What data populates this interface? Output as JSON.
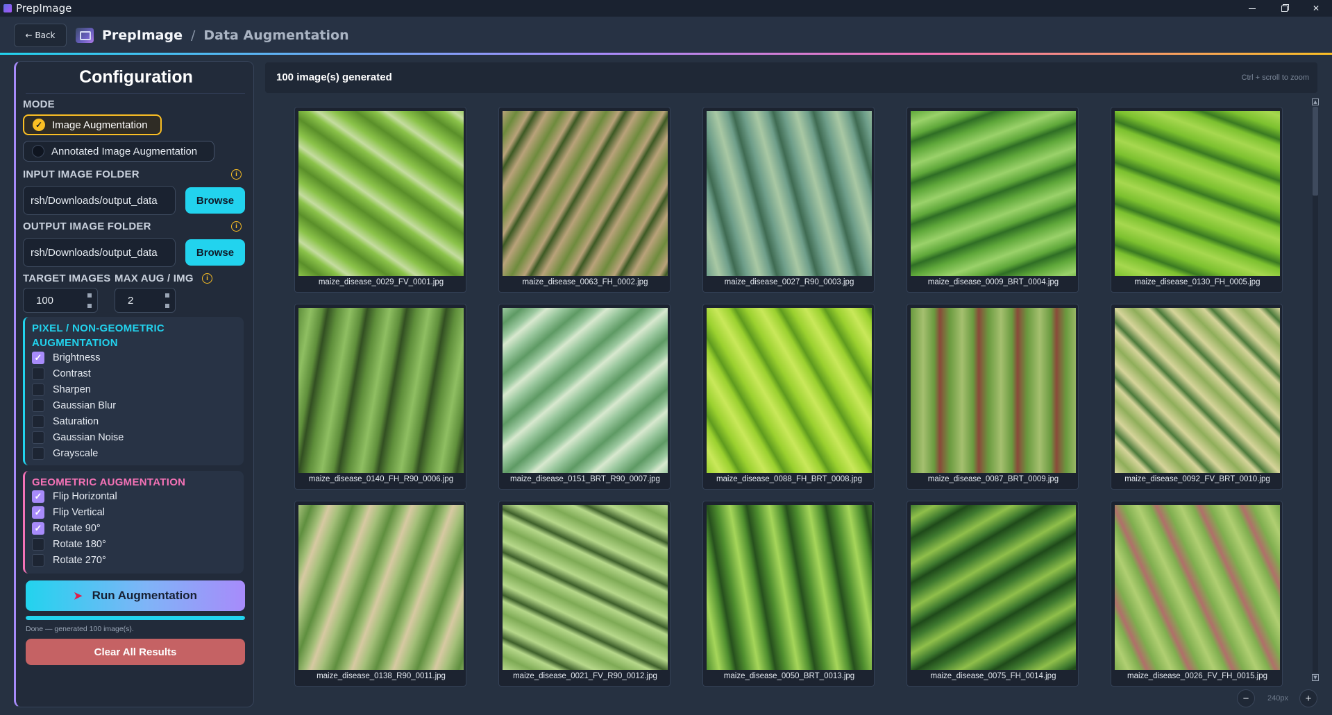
{
  "window": {
    "title": "PrepImage",
    "controls": [
      "minimize",
      "maximize",
      "close"
    ],
    "close_glyph": "✕"
  },
  "header": {
    "back_label": "← Back",
    "brand": "PrepImage",
    "separator": "/",
    "page": "Data Augmentation"
  },
  "config": {
    "title": "Configuration",
    "mode_label": "MODE",
    "modes": [
      {
        "label": "Image Augmentation",
        "selected": true
      },
      {
        "label": "Annotated Image Augmentation",
        "selected": false
      }
    ],
    "input_folder_label": "INPUT IMAGE FOLDER",
    "input_folder_value": "rsh/Downloads/output_data",
    "output_folder_label": "OUTPUT IMAGE FOLDER",
    "output_folder_value": "rsh/Downloads/output_data",
    "browse_label": "Browse",
    "target_images_label": "TARGET IMAGES",
    "target_images_value": "100",
    "max_aug_label": "MAX AUG / IMG",
    "max_aug_value": "2",
    "info_glyph": "i",
    "pixel_group": {
      "title": "PIXEL / NON-GEOMETRIC AUGMENTATION",
      "accent": "#22d3ee",
      "items": [
        {
          "label": "Brightness",
          "checked": true
        },
        {
          "label": "Contrast",
          "checked": false
        },
        {
          "label": "Sharpen",
          "checked": false
        },
        {
          "label": "Gaussian Blur",
          "checked": false
        },
        {
          "label": "Saturation",
          "checked": false
        },
        {
          "label": "Gaussian Noise",
          "checked": false
        },
        {
          "label": "Grayscale",
          "checked": false
        }
      ]
    },
    "geo_group": {
      "title": "GEOMETRIC AUGMENTATION",
      "accent": "#f472b6",
      "items": [
        {
          "label": "Flip Horizontal",
          "checked": true
        },
        {
          "label": "Flip Vertical",
          "checked": true
        },
        {
          "label": "Rotate 90°",
          "checked": true
        },
        {
          "label": "Rotate 180°",
          "checked": false
        },
        {
          "label": "Rotate 270°",
          "checked": false
        }
      ]
    },
    "run_label": "Run Augmentation",
    "run_icon": "rocket-icon",
    "progress_fraction": 1.0,
    "status_text": "Done — generated 100 image(s).",
    "clear_label": "Clear All Results"
  },
  "results": {
    "count_text": "100 image(s) generated",
    "zoom_hint": "Ctrl + scroll to zoom",
    "zoom_value": "240px",
    "zoom_out": "−",
    "zoom_in": "+",
    "images": [
      {
        "name": "maize_disease_0029_FV_0001.jpg",
        "palette": [
          "#8bc34a",
          "#5a8f2a",
          "#c5dca0"
        ]
      },
      {
        "name": "maize_disease_0063_FH_0002.jpg",
        "palette": [
          "#b9a27a",
          "#6e8b3d",
          "#3d5a24"
        ]
      },
      {
        "name": "maize_disease_0027_R90_0003.jpg",
        "palette": [
          "#6e9e8a",
          "#a9c8a4",
          "#3f6b52"
        ]
      },
      {
        "name": "maize_disease_0009_BRT_0004.jpg",
        "palette": [
          "#5fa83a",
          "#9ad26a",
          "#2f6e25"
        ]
      },
      {
        "name": "maize_disease_0130_FH_0005.jpg",
        "palette": [
          "#7cc12f",
          "#a6d84f",
          "#3a7a22"
        ]
      },
      {
        "name": "maize_disease_0140_FH_R90_0006.jpg",
        "palette": [
          "#5f8f3b",
          "#8fbf62",
          "#324f22"
        ]
      },
      {
        "name": "maize_disease_0151_BRT_R90_0007.jpg",
        "palette": [
          "#9cc9a0",
          "#5e9a64",
          "#d8e8cf"
        ]
      },
      {
        "name": "maize_disease_0088_FH_BRT_0008.jpg",
        "palette": [
          "#9bd12f",
          "#c9e85a",
          "#5f9b1f"
        ]
      },
      {
        "name": "maize_disease_0087_BRT_0009.jpg",
        "palette": [
          "#6a9a3f",
          "#a5c06f",
          "#8a4a3a"
        ]
      },
      {
        "name": "maize_disease_0092_FV_BRT_0010.jpg",
        "palette": [
          "#d6d49a",
          "#8fae5a",
          "#4b7a3a"
        ]
      },
      {
        "name": "maize_disease_0138_R90_0011.jpg",
        "palette": [
          "#a5c07a",
          "#5f8f3f",
          "#d7c9a2"
        ]
      },
      {
        "name": "maize_disease_0021_FV_R90_0012.jpg",
        "palette": [
          "#b6d88a",
          "#7eaa55",
          "#3d5f2a"
        ]
      },
      {
        "name": "maize_disease_0050_BRT_0013.jpg",
        "palette": [
          "#4f8f2f",
          "#a6d65a",
          "#26501d"
        ]
      },
      {
        "name": "maize_disease_0075_FH_0014.jpg",
        "palette": [
          "#3f7a2f",
          "#8fbf4a",
          "#1f4a1a"
        ]
      },
      {
        "name": "maize_disease_0026_FV_FH_0015.jpg",
        "palette": [
          "#7fae4f",
          "#b0cf72",
          "#b0706a"
        ]
      }
    ]
  }
}
